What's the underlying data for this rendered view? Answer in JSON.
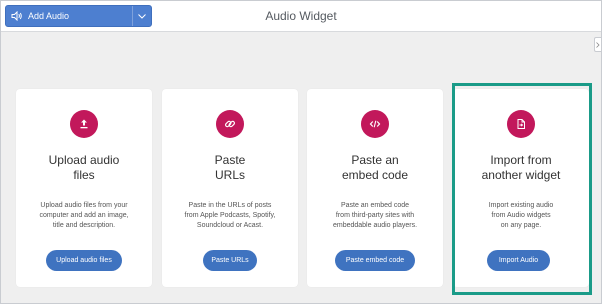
{
  "header": {
    "add_audio_label": "Add Audio",
    "title": "Audio Widget"
  },
  "colors": {
    "accent_blue": "#4d7fd0",
    "icon_circle": "#c2185b",
    "action_button": "#3f73c0",
    "highlight_border": "#1a9b88"
  },
  "cards": [
    {
      "icon": "upload-icon",
      "title_line1": "Upload audio",
      "title_line2": "files",
      "desc_line1": "Upload audio files from your",
      "desc_line2": "computer and add an image,",
      "desc_line3": "title and description.",
      "button": "Upload audio files"
    },
    {
      "icon": "link-icon",
      "title_line1": "Paste",
      "title_line2": "URLs",
      "desc_line1": "Paste in the URLs of posts",
      "desc_line2": "from Apple Podcasts, Spotify,",
      "desc_line3": "Soundcloud or Acast.",
      "button": "Paste URLs"
    },
    {
      "icon": "code-icon",
      "title_line1": "Paste an",
      "title_line2": "embed code",
      "desc_line1": "Paste an embed code",
      "desc_line2": "from third-party sites with",
      "desc_line3": "embeddable audio players.",
      "button": "Paste embed code"
    },
    {
      "icon": "import-file-icon",
      "title_line1": "Import from",
      "title_line2": "another widget",
      "desc_line1": "Import existing audio",
      "desc_line2": "from Audio widgets",
      "desc_line3": "on any page.",
      "button": "Import Audio"
    }
  ]
}
